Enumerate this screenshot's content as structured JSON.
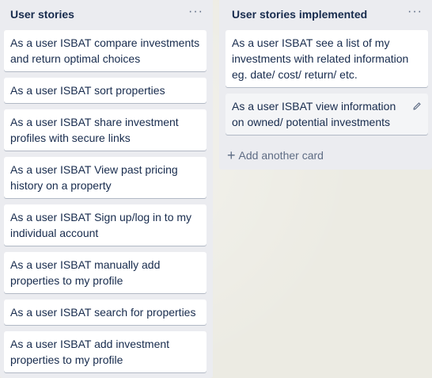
{
  "lists": [
    {
      "title": "User stories",
      "menu": "···",
      "cards": [
        "As a user ISBAT compare investments and return optimal choices",
        "As a user ISBAT sort properties",
        "As a user ISBAT share investment profiles with secure links",
        "As a user ISBAT View past pricing history on a property",
        "As a user ISBAT Sign up/log in to my individual account",
        "As a user ISBAT manually add properties to my profile",
        "As a user ISBAT search for properties",
        "As a user ISBAT add investment properties to my profile"
      ]
    },
    {
      "title": "User stories implemented",
      "menu": "···",
      "cards": [
        "As a user ISBAT see a list of my investments with related information eg. date/ cost/ return/ etc.",
        "As a user ISBAT view information on owned/ potential investments"
      ],
      "add_card_label": "Add another card"
    }
  ],
  "icons": {
    "menu": "ellipsis-icon",
    "edit": "pencil-icon",
    "add": "plus-icon"
  },
  "colors": {
    "list_bg": "#ebecf0",
    "card_bg": "#ffffff",
    "text": "#172b4d",
    "muted": "#5e6c84"
  }
}
